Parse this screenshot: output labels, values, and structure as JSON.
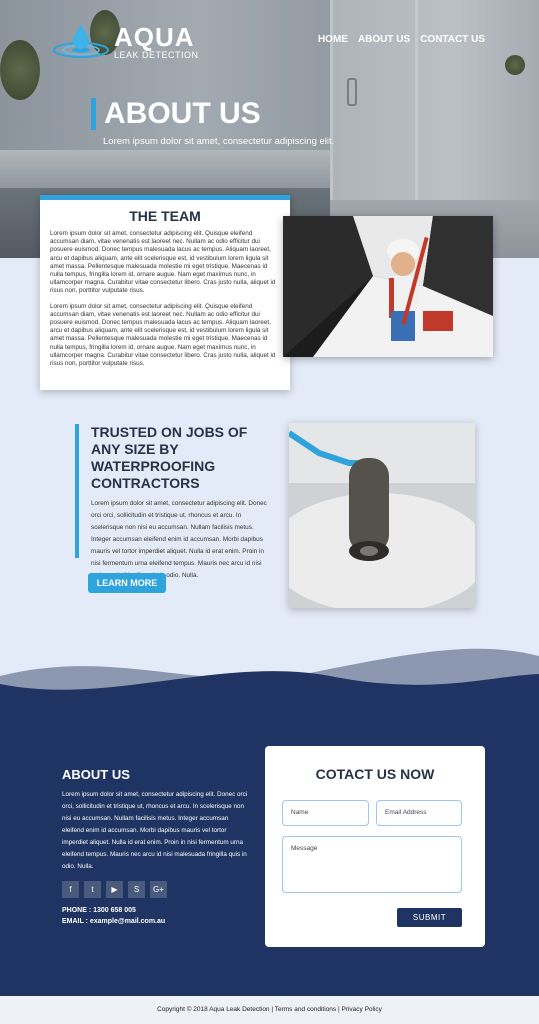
{
  "brand": {
    "name": "AQUA",
    "tagline": "LEAK DETECTION"
  },
  "nav": {
    "items": [
      "HOME",
      "ABOUT US",
      "CONTACT US"
    ]
  },
  "hero": {
    "title": "ABOUT US",
    "subtitle": "Lorem ipsum dolor sit amet, consectetur adipiscing elit."
  },
  "team": {
    "title": "THE TEAM",
    "paragraphs": [
      "Lorem ipsum dolor sit amet, consectetur adipiscing elit. Quisque eleifend accumsan diam, vitae venenatis est laoreet nec. Nullam ac odio efficitur dui posuere euismod. Donec tempus malesuada lacus ac tempus. Aliquam laoreet, arcu et dapibus aliquam, ante elit scelerisque est, id vestibulum lorem ligula sit amet massa. Pellentesque malesuada molestie mi eget tristique. Maecenas id nulla tempus, fringilla lorem id, ornare augue. Nam eget maximus nunc, in ullamcorper magna. Curabitur vitae consectetur libero. Cras justo nulla, aliquet id risus non, porttitor vulputate risus.",
      "Lorem ipsum dolor sit amet, consectetur adipiscing elit. Quisque eleifend accumsan diam, vitae venenatis est laoreet nec. Nullam ac odio efficitur dui posuere euismod. Donec tempus malesuada lacus ac tempus. Aliquam laoreet, arcu et dapibus aliquam, ante elit scelerisque est, id vestibulum lorem ligula sit amet massa. Pellentesque malesuada molestie mi eget tristique. Maecenas id nulla tempus, fringilla lorem id, ornare augue. Nam eget maximus nunc, in ullamcorper magna. Curabitur vitae consectetur libero. Cras justo nulla, aliquet id risus non, porttitor vulputate risus."
    ]
  },
  "trusted": {
    "title": "TRUSTED ON JOBS OF ANY SIZE BY WATERPROOFING CONTRACTORS",
    "text": "Lorem ipsum dolor sit amet, consectetur adipiscing elit. Donec orci orci, sollicitudin et tristique ut, rhoncus et arcu. In scelerisque non nisi eu accumsan. Nullam facilisis metus. Integer accumsan eleifend enim id accumsan. Morbi dapibus mauris vel tortor imperdiet aliquet. Nulla id erat enim. Proin in nisi fermentum urna eleifend tempus. Mauris nec arcu id nisi malesuada fringilla quis in odio. Nulla.",
    "button": "LEARN MORE"
  },
  "footer": {
    "about_title": "ABOUT US",
    "about_text": "Lorem ipsum dolor sit amet, consectetur adipiscing elit. Donec orci orci, sollicitudin et tristique ut, rhoncus et arcu. In scelerisque non nisi eu accumsan. Nullam facilisis metus. Integer accumsan eleifend enim id accumsan. Morbi dapibus mauris vel tortor imperdiet aliquet. Nulla id erat enim. Proin in nisi fermentum urna eleifend tempus. Mauris nec arcu id nisi malesuada fringilla quis in odio. Nulla.",
    "social_icons": [
      "facebook-icon",
      "twitter-icon",
      "youtube-icon",
      "skype-icon",
      "google-plus-icon"
    ],
    "phone": "PHONE : 1300 658 005",
    "email": "EMAIL : example@mail.com.au"
  },
  "contact": {
    "title": "COTACT US NOW",
    "name_placeholder": "Name",
    "email_placeholder": "Email Address",
    "message_placeholder": "Message",
    "submit": "SUBMIT"
  },
  "copyright": "Copyright © 2018 Aqua Leak Detection | Terms and conditions | Privacy Policy",
  "colors": {
    "accent": "#2ea3dc",
    "navy": "#1f3462",
    "page_bg": "#e4ebf8"
  }
}
